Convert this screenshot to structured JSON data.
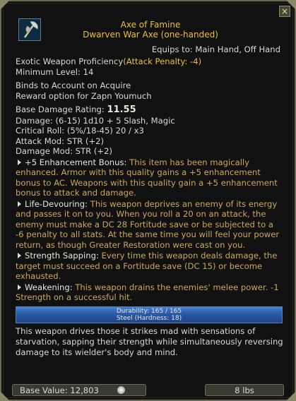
{
  "header": {
    "name": "Axe of Famine",
    "subtitle": "Dwarven War Axe (one-handed)",
    "equips": "Equips to: Main Hand, Off Hand"
  },
  "close_glyph": "×",
  "props": {
    "proficiency": "Exotic Weapon Proficiency",
    "proficiency_penalty": "(Attack Penalty: -4)",
    "min_level": "Minimum Level: 14",
    "binds": "Binds to Account on Acquire",
    "reward": "Reward option for Zapn Youmuch",
    "base_damage_label": "Base Damage Rating:",
    "base_damage_value": "11.55",
    "damage": "Damage: (6-15) 1d10 + 5 Slash, Magic",
    "critical": "Critical Roll: (5%/18-45) 20 / x3",
    "attack_mod": "Attack Mod: STR (+2)",
    "damage_mod": "Damage Mod: STR (+2)"
  },
  "enchantments": [
    {
      "title": "+5 Enhancement Bonus:",
      "text": " This item has been magically enhanced. Armor with this quality gains a +5 enhancement bonus to AC. Weapons with this quality gain a +5 enhancement bonus to attack and damage."
    },
    {
      "title": "Life-Devouring:",
      "text": " This weapon deprives an enemy of its energy and passes it on to you. When you roll a 20 on an attack, the enemy must make a DC 28 Fortitude save or be subjected to a -6 penalty to all stats. At the same time you will feel your power return, as though Greater Restoration were cast on you."
    },
    {
      "title": "Strength Sapping:",
      "text": " Every time this weapon deals damage, the target must succeed on a Fortitude save (DC 15) or become exhausted."
    },
    {
      "title": "Weakening:",
      "text": " This weapon drains the enemies' melee power. -1 Strength on a successful hit."
    }
  ],
  "durability": {
    "text": "Durability: 165 / 165",
    "material": "Steel (Hardness: 18)",
    "fraction": 1.0
  },
  "description": "This weapon drives those it strikes mad with sensations of starvation, sapping their strength while simultaneously reversing damage to its wielder's body and mind.",
  "footer": {
    "base_value": "Base Value: 12,803",
    "weight": "8 lbs"
  },
  "colors": {
    "title": "#e8c13a",
    "enchant_text": "#c9a85a",
    "durability_bar": "#1d4fa0"
  },
  "icons": [
    "axe-icon",
    "coin-icon",
    "close-icon",
    "arrow-bullet-icon"
  ]
}
